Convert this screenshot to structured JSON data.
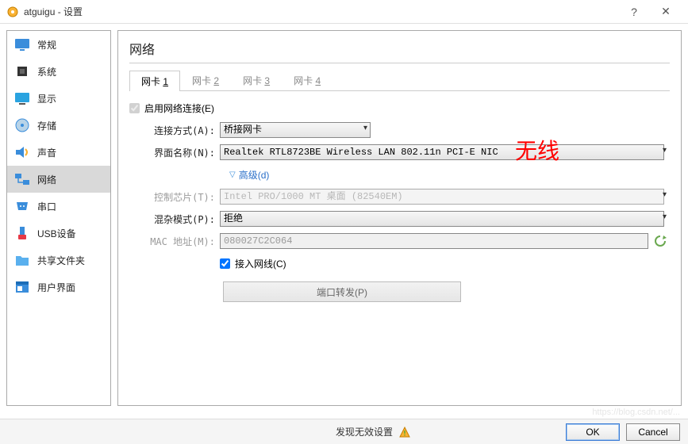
{
  "window": {
    "title": "atguigu - 设置"
  },
  "sidebar": {
    "items": [
      {
        "label": "常规"
      },
      {
        "label": "系统"
      },
      {
        "label": "显示"
      },
      {
        "label": "存储"
      },
      {
        "label": "声音"
      },
      {
        "label": "网络"
      },
      {
        "label": "串口"
      },
      {
        "label": "USB设备"
      },
      {
        "label": "共享文件夹"
      },
      {
        "label": "用户界面"
      }
    ]
  },
  "content": {
    "heading": "网络",
    "tabs": [
      {
        "prefix": "网卡 ",
        "num": "1"
      },
      {
        "prefix": "网卡 ",
        "num": "2"
      },
      {
        "prefix": "网卡 ",
        "num": "3"
      },
      {
        "prefix": "网卡 ",
        "num": "4"
      }
    ],
    "enable_label": "启用网络连接(E)",
    "conn_label": "连接方式(A):",
    "conn_value": "桥接网卡",
    "iface_label": "界面名称(N):",
    "iface_value": "Realtek RTL8723BE Wireless LAN 802.11n PCI-E NIC",
    "adv_label": "高级(d)",
    "chip_label": "控制芯片(T):",
    "chip_value": "Intel PRO/1000 MT 桌面 (82540EM)",
    "prom_label": "混杂模式(P):",
    "prom_value": "拒绝",
    "mac_label": "MAC 地址(M):",
    "mac_value": "080027C2C064",
    "cable_label": "接入网线(C)",
    "port_fwd": "端口转发(P)",
    "annotation": "无线"
  },
  "footer": {
    "msg": "发现无效设置",
    "ok": "OK",
    "cancel": "Cancel"
  }
}
